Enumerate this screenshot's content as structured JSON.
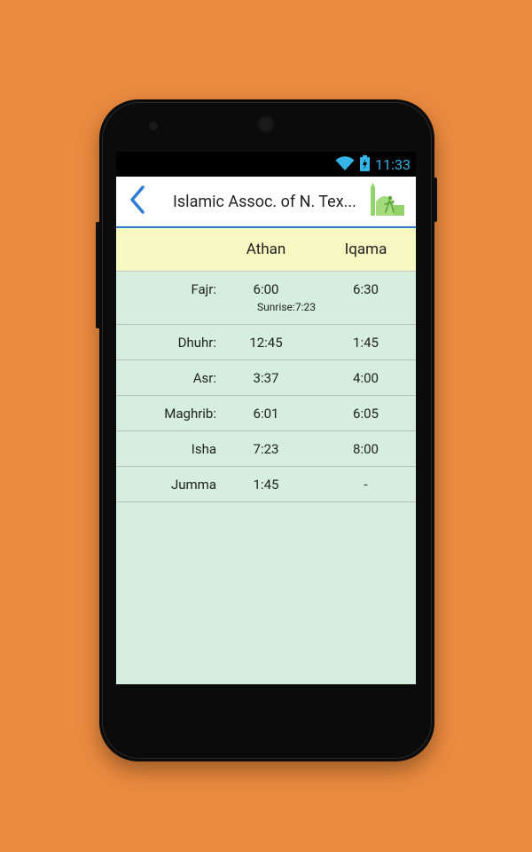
{
  "status_bar": {
    "time": "11:33",
    "wifi_icon": "wifi-icon",
    "battery_icon": "battery-charging-icon",
    "accent_color": "#33B5E5"
  },
  "action_bar": {
    "title": "Islamic Assoc. of N. Tex...",
    "back_icon": "chevron-left-icon",
    "logo_icon": "mosque-logo-icon"
  },
  "table": {
    "headers": {
      "prayer": "",
      "athan": "Athan",
      "iqama": "Iqama"
    },
    "rows": [
      {
        "prayer": "Fajr:",
        "athan": "6:00",
        "iqama": "6:30",
        "note": "Sunrise:7:23"
      },
      {
        "prayer": "Dhuhr:",
        "athan": "12:45",
        "iqama": "1:45"
      },
      {
        "prayer": "Asr:",
        "athan": "3:37",
        "iqama": "4:00"
      },
      {
        "prayer": "Maghrib:",
        "athan": "6:01",
        "iqama": "6:05"
      },
      {
        "prayer": "Isha",
        "athan": "7:23",
        "iqama": "8:00"
      },
      {
        "prayer": "Jumma",
        "athan": "1:45",
        "iqama": "-"
      }
    ]
  },
  "colors": {
    "background": "#EC8B3F",
    "header_bg": "#F6F7C1",
    "content_bg": "#D6EEDD",
    "actionbar_divider": "#2E7CD6"
  }
}
